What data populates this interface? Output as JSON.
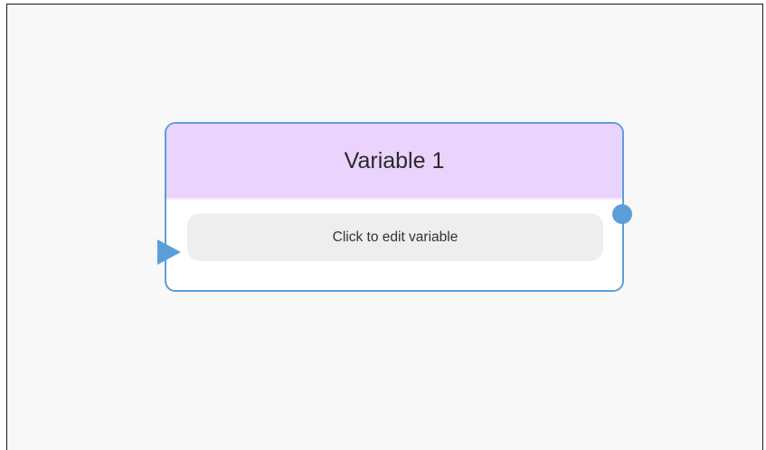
{
  "node": {
    "title": "Variable 1",
    "edit_label": "Click to edit variable"
  },
  "colors": {
    "header_bg": "#ead3fd",
    "border": "#5b9fd8",
    "port": "#5b9fd8",
    "button_bg": "#eeeeee",
    "canvas_bg": "#f8f8f8"
  },
  "icons": {
    "input_port": "triangle-right-icon",
    "output_port": "circle-icon"
  }
}
